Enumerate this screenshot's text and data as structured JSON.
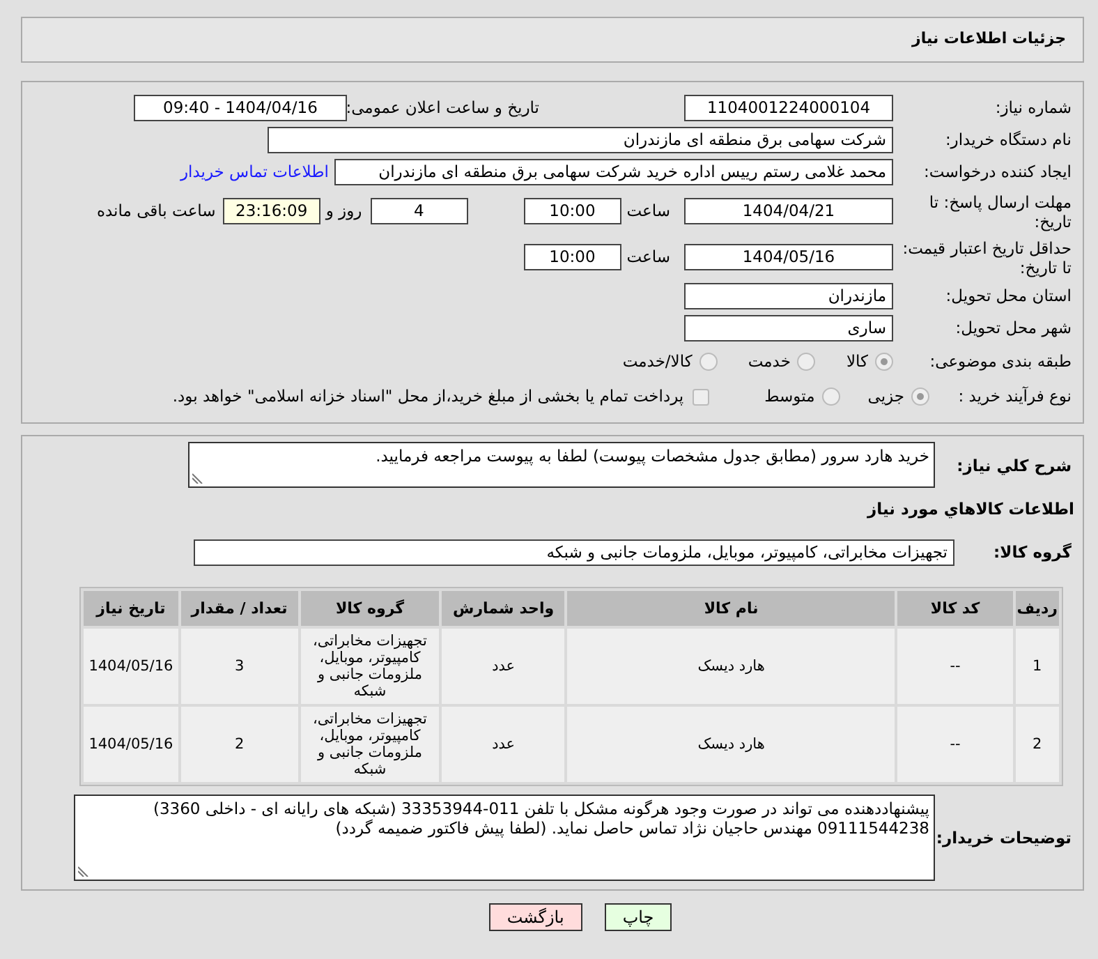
{
  "header": {
    "title": "جزئیات اطلاعات نیاز"
  },
  "need_number": {
    "label": "شماره نیاز:",
    "value": "1104001224000104"
  },
  "announce": {
    "label": "تاریخ و ساعت اعلان عمومی:",
    "value": "1404/04/16 - 09:40"
  },
  "buyer_org": {
    "label": "نام دستگاه خریدار:",
    "value": "شرکت سهامی برق منطقه ای مازندران"
  },
  "requester": {
    "label": "ایجاد کننده درخواست:",
    "value": "محمد غلامی رستم رییس اداره خرید شرکت سهامی برق منطقه ای مازندران",
    "link": "اطلاعات تماس خریدار"
  },
  "reply_deadline": {
    "label": "مهلت ارسال پاسخ: تا تاریخ:",
    "date": "1404/04/21",
    "time_label": "ساعت",
    "time": "10:00",
    "days": "4",
    "days_label": "روز و",
    "remaining": "23:16:09",
    "remaining_label": "ساعت باقی مانده"
  },
  "price_validity": {
    "label": "حداقل تاریخ اعتبار قیمت: تا تاریخ:",
    "date": "1404/05/16",
    "time_label": "ساعت",
    "time": "10:00"
  },
  "province": {
    "label": "استان محل تحویل:",
    "value": "مازندران"
  },
  "city": {
    "label": "شهر محل تحویل:",
    "value": "ساری"
  },
  "category": {
    "label": "طبقه بندی موضوعی:",
    "options": [
      {
        "label": "کالا",
        "selected": true
      },
      {
        "label": "خدمت",
        "selected": false
      },
      {
        "label": "کالا/خدمت",
        "selected": false
      }
    ]
  },
  "process": {
    "label": "نوع فرآیند خرید :",
    "options": [
      {
        "label": "جزیی",
        "selected": true
      },
      {
        "label": "متوسط",
        "selected": false
      }
    ],
    "treasury": {
      "label": "پرداخت تمام یا بخشی از مبلغ خرید،از محل \"اسناد خزانه اسلامی\" خواهد بود.",
      "checked": false
    }
  },
  "description": {
    "label": "شرح کلي نیاز:",
    "value": "خرید هارد سرور (مطابق جدول مشخصات پیوست) لطفا به پیوست مراجعه فرمایید."
  },
  "goods_heading": "اطلاعات کالاهاي مورد نیاز",
  "goods_group": {
    "label": "گروه کالا:",
    "value": "تجهیزات مخابراتی، کامپیوتر، موبایل، ملزومات جانبی و شبکه"
  },
  "table": {
    "columns": [
      "ردیف",
      "کد کالا",
      "نام کالا",
      "واحد شمارش",
      "گروه کالا",
      "تعداد / مقدار",
      "تاریخ نیاز"
    ],
    "rows": [
      [
        "1",
        "--",
        "هارد دیسک",
        "عدد",
        "تجهیزات مخابراتی، کامپیوتر، موبایل، ملزومات جانبی و شبکه",
        "3",
        "1404/05/16"
      ],
      [
        "2",
        "--",
        "هارد دیسک",
        "عدد",
        "تجهیزات مخابراتی، کامپیوتر، موبایل، ملزومات جانبی و شبکه",
        "2",
        "1404/05/16"
      ]
    ]
  },
  "buyer_notes": {
    "label": "توضیحات خریدار:",
    "value": "پیشنهاددهنده می تواند در صورت وجود هرگونه مشکل با تلفن 011-33353944 (شبکه های رایانه ای - داخلی 3360) 09111544238 مهندس حاجیان نژاد تماس حاصل نماید. (لطفا پیش فاکتور ضمیمه گردد)"
  },
  "buttons": [
    {
      "label": "چاپ",
      "kind": "print"
    },
    {
      "label": "بازگشت",
      "kind": "back"
    }
  ]
}
